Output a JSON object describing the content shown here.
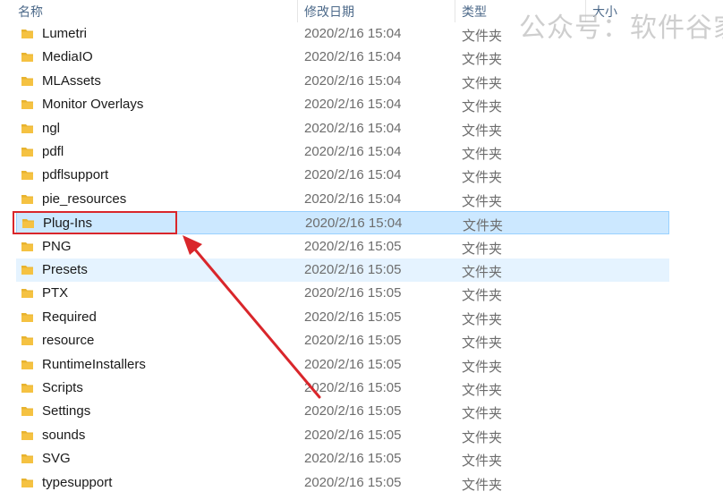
{
  "columns": {
    "name": "名称",
    "modified": "修改日期",
    "type": "类型",
    "size": "大小"
  },
  "sort_indicator": "^",
  "watermark": "公众号：软件谷家",
  "colors": {
    "selected_bg": "#cce8ff",
    "hover_bg": "#e5f3ff",
    "annotation_red": "#d9262b",
    "folder_yellow": "#f5c242"
  },
  "rows": [
    {
      "name": "Lumetri",
      "date": "2020/2/16 15:04",
      "type": "文件夹"
    },
    {
      "name": "MediaIO",
      "date": "2020/2/16 15:04",
      "type": "文件夹"
    },
    {
      "name": "MLAssets",
      "date": "2020/2/16 15:04",
      "type": "文件夹"
    },
    {
      "name": "Monitor Overlays",
      "date": "2020/2/16 15:04",
      "type": "文件夹"
    },
    {
      "name": "ngl",
      "date": "2020/2/16 15:04",
      "type": "文件夹"
    },
    {
      "name": "pdfl",
      "date": "2020/2/16 15:04",
      "type": "文件夹"
    },
    {
      "name": "pdflsupport",
      "date": "2020/2/16 15:04",
      "type": "文件夹"
    },
    {
      "name": "pie_resources",
      "date": "2020/2/16 15:04",
      "type": "文件夹"
    },
    {
      "name": "Plug-Ins",
      "date": "2020/2/16 15:04",
      "type": "文件夹",
      "state": "selected"
    },
    {
      "name": "PNG",
      "date": "2020/2/16 15:05",
      "type": "文件夹"
    },
    {
      "name": "Presets",
      "date": "2020/2/16 15:05",
      "type": "文件夹",
      "state": "hover"
    },
    {
      "name": "PTX",
      "date": "2020/2/16 15:05",
      "type": "文件夹"
    },
    {
      "name": "Required",
      "date": "2020/2/16 15:05",
      "type": "文件夹"
    },
    {
      "name": "resource",
      "date": "2020/2/16 15:05",
      "type": "文件夹"
    },
    {
      "name": "RuntimeInstallers",
      "date": "2020/2/16 15:05",
      "type": "文件夹"
    },
    {
      "name": "Scripts",
      "date": "2020/2/16 15:05",
      "type": "文件夹"
    },
    {
      "name": "Settings",
      "date": "2020/2/16 15:05",
      "type": "文件夹"
    },
    {
      "name": "sounds",
      "date": "2020/2/16 15:05",
      "type": "文件夹"
    },
    {
      "name": "SVG",
      "date": "2020/2/16 15:05",
      "type": "文件夹"
    },
    {
      "name": "typesupport",
      "date": "2020/2/16 15:05",
      "type": "文件夹"
    }
  ]
}
